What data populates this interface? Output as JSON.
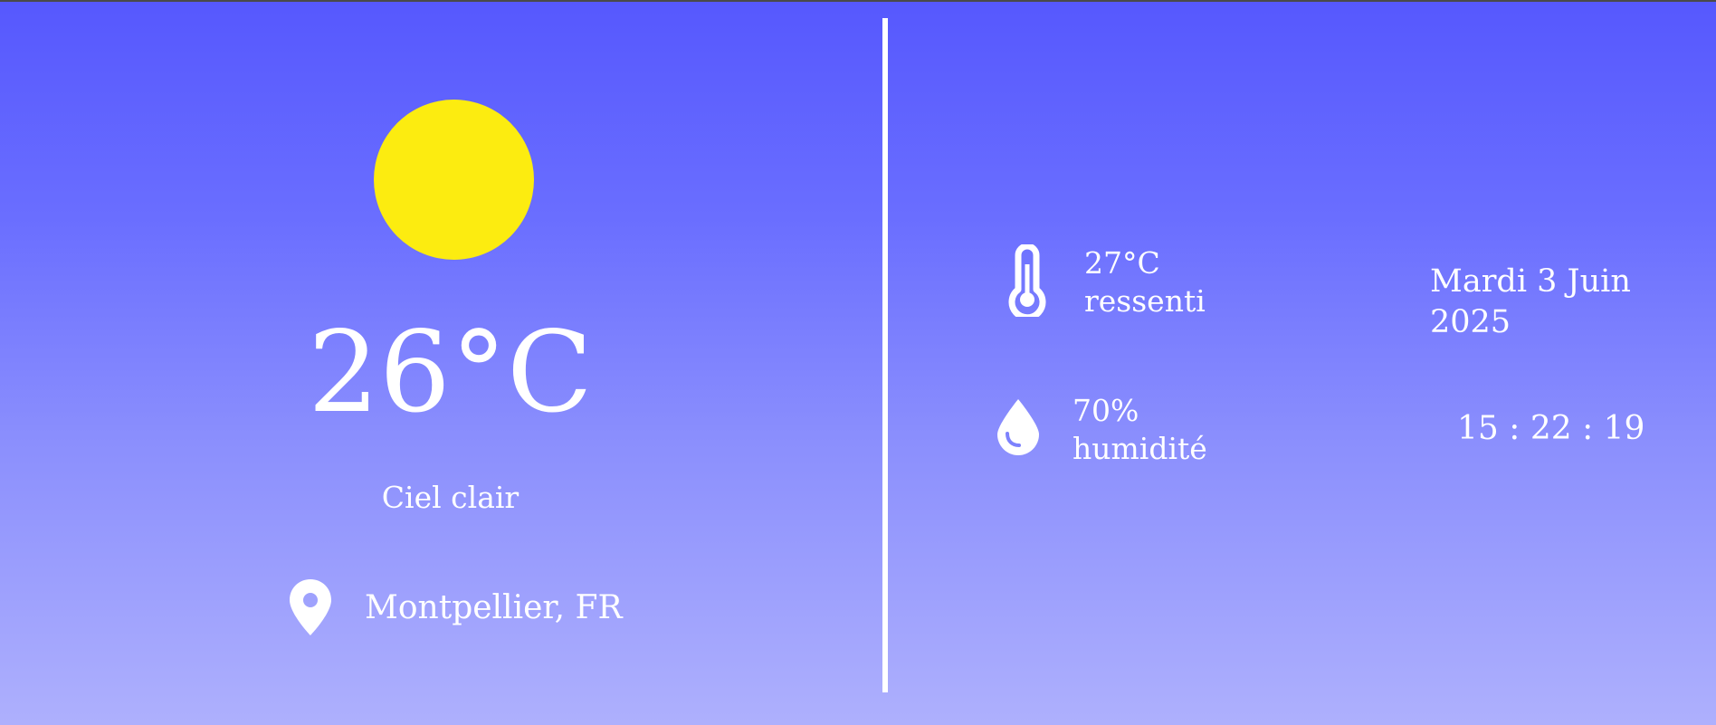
{
  "colors": {
    "background_top": "#5658fe",
    "background_bottom": "#aeb0fd",
    "sun": "#fcec10",
    "text": "#ffffff"
  },
  "weather": {
    "icon": "sun-icon",
    "temperature": "26°C",
    "condition": "Ciel clair",
    "location_icon": "location-pin-icon",
    "location": "Montpellier, FR"
  },
  "details": {
    "feels_like": {
      "icon": "thermometer-icon",
      "value": "27°C",
      "label": "ressenti"
    },
    "humidity": {
      "icon": "water-drop-icon",
      "value": "70%",
      "label": "humidité"
    }
  },
  "datetime": {
    "date": "Mardi 3 Juin 2025",
    "time": "15 : 22 : 19"
  }
}
